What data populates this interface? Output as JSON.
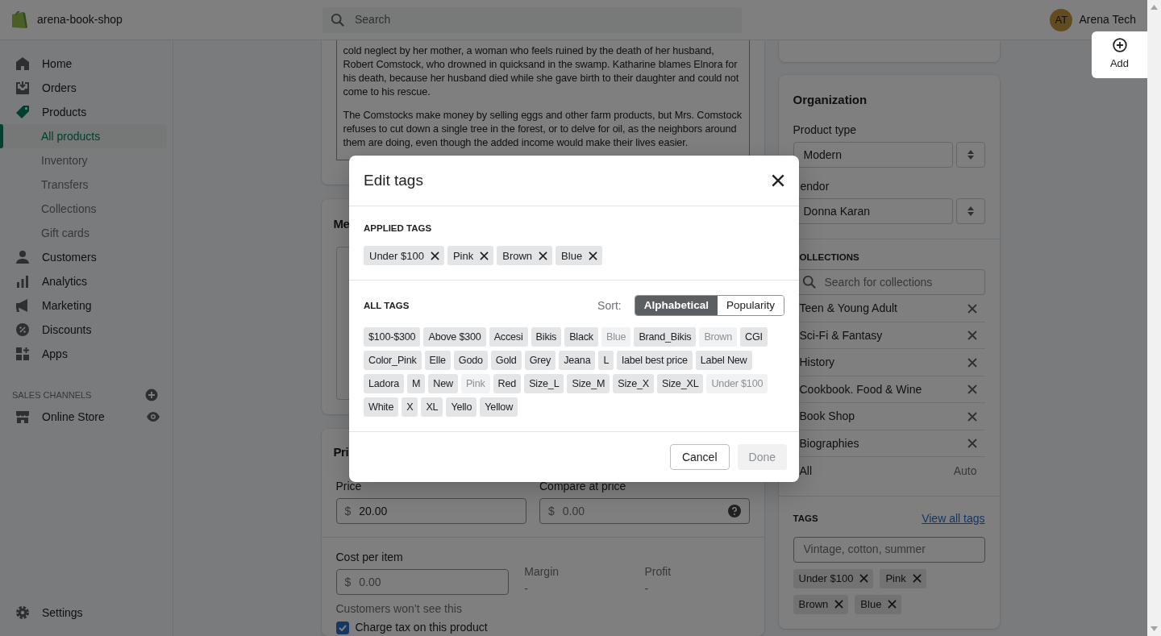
{
  "topbar": {
    "shop_name": "arena-book-shop",
    "search": {
      "placeholder": "Search"
    },
    "user": {
      "initials": "AT",
      "name": "Arena Tech"
    }
  },
  "sidebar": {
    "items": [
      {
        "label": "Home",
        "expanded": false
      },
      {
        "label": "Orders",
        "expanded": false
      },
      {
        "label": "Products",
        "expanded": true,
        "children": [
          {
            "label": "All products",
            "selected": true
          },
          {
            "label": "Inventory",
            "selected": false
          },
          {
            "label": "Transfers",
            "selected": false
          },
          {
            "label": "Collections",
            "selected": false
          },
          {
            "label": "Gift cards",
            "selected": false
          }
        ]
      },
      {
        "label": "Customers",
        "expanded": false
      },
      {
        "label": "Analytics",
        "expanded": false
      },
      {
        "label": "Marketing",
        "expanded": false
      },
      {
        "label": "Discounts",
        "expanded": false
      },
      {
        "label": "Apps",
        "expanded": false
      }
    ],
    "sales_channels": {
      "title": "SALES CHANNELS",
      "items": [
        {
          "label": "Online Store"
        }
      ]
    },
    "settings": {
      "label": "Settings"
    }
  },
  "description": {
    "paragraphs": [
      "cold neglect by her mother, a woman who feels ruined by the death of her husband, Robert Comstock, who drowned in quicksand in the swamp. Katharine blames Elnora for his death, because her husband died while she gave birth to their daughter and could not come to his rescue.",
      "The Comstocks make money by selling eggs and other farm products, but Mrs. Comstock refuses to cut down a single tree in the forest, or to delve for oil, as the neighbors around them are doing, even though the added income would make their lives easier."
    ]
  },
  "media": {
    "title": "Me"
  },
  "pricing": {
    "title": "Pri",
    "price": {
      "label": "Price",
      "prefix": "$",
      "value": "20.00"
    },
    "compare_at": {
      "label": "Compare at price",
      "prefix": "$",
      "placeholder": "0.00"
    },
    "cost": {
      "label": "Cost per item",
      "prefix": "$",
      "placeholder": "0.00"
    },
    "margin": {
      "label": "Margin",
      "value": "-"
    },
    "profit": {
      "label": "Profit",
      "value": "-"
    },
    "cost_note": "Customers won’t see this",
    "charge_tax": {
      "label": "Charge tax on this product",
      "checked": true
    }
  },
  "organization": {
    "title": "Organization",
    "product_type": {
      "label": "Product type",
      "value": "Modern"
    },
    "vendor": {
      "label": "endor",
      "value": "Donna Karan"
    }
  },
  "collections": {
    "title": "OLLECTIONS",
    "search": {
      "placeholder": "Search for collections"
    },
    "items": [
      {
        "kind": "manual",
        "name": "Teen & Young Adult"
      },
      {
        "kind": "manual",
        "name": "Sci-Fi & Fantasy"
      },
      {
        "kind": "manual",
        "name": "History"
      },
      {
        "kind": "manual",
        "name": "Cookbook. Food & Wine"
      },
      {
        "kind": "manual",
        "name": "Book Shop"
      },
      {
        "kind": "manual",
        "name": "Biographies"
      },
      {
        "kind": "auto",
        "name": "All",
        "status": "Auto"
      }
    ]
  },
  "tags": {
    "title": "TAGS",
    "link": "View all tags",
    "placeholder": "Vintage, cotton, summer",
    "chips": [
      "Under $100",
      "Pink",
      "Brown",
      "Blue"
    ]
  },
  "add_button": {
    "label": "Add"
  },
  "modal": {
    "title": "Edit tags",
    "applied": {
      "title": "APPLIED TAGS",
      "tags": [
        "Under $100",
        "Pink",
        "Brown",
        "Blue"
      ]
    },
    "all": {
      "title": "ALL TAGS",
      "sort_label": "Sort:",
      "sort_options": [
        {
          "label": "Alphabetical",
          "selected": true
        },
        {
          "label": "Popularity",
          "selected": false
        }
      ],
      "tags": [
        {
          "label": "$100-$300",
          "applied": false
        },
        {
          "label": "Above $300",
          "applied": false
        },
        {
          "label": "Accesi",
          "applied": false
        },
        {
          "label": "Bikis",
          "applied": false
        },
        {
          "label": "Black",
          "applied": false
        },
        {
          "label": "Blue",
          "applied": true
        },
        {
          "label": "Brand_Bikis",
          "applied": false
        },
        {
          "label": "Brown",
          "applied": true
        },
        {
          "label": "CGI",
          "applied": false
        },
        {
          "label": "Color_Pink",
          "applied": false
        },
        {
          "label": "Elle",
          "applied": false
        },
        {
          "label": "Godo",
          "applied": false
        },
        {
          "label": "Gold",
          "applied": false
        },
        {
          "label": "Grey",
          "applied": false
        },
        {
          "label": "Jeana",
          "applied": false
        },
        {
          "label": "L",
          "applied": false
        },
        {
          "label": "label best price",
          "applied": false
        },
        {
          "label": "Label New",
          "applied": false
        },
        {
          "label": "Ladora",
          "applied": false
        },
        {
          "label": "M",
          "applied": false
        },
        {
          "label": "New",
          "applied": false
        },
        {
          "label": "Pink",
          "applied": true
        },
        {
          "label": "Red",
          "applied": false
        },
        {
          "label": "Size_L",
          "applied": false
        },
        {
          "label": "Size_M",
          "applied": false
        },
        {
          "label": "Size_X",
          "applied": false
        },
        {
          "label": "Size_XL",
          "applied": false
        },
        {
          "label": "Under $100",
          "applied": true
        },
        {
          "label": "White",
          "applied": false
        },
        {
          "label": "X",
          "applied": false
        },
        {
          "label": "XL",
          "applied": false
        },
        {
          "label": "Yello",
          "applied": false
        },
        {
          "label": "Yellow",
          "applied": false
        }
      ]
    },
    "cancel": {
      "label": "Cancel"
    },
    "done": {
      "label": "Done",
      "disabled": true
    }
  }
}
